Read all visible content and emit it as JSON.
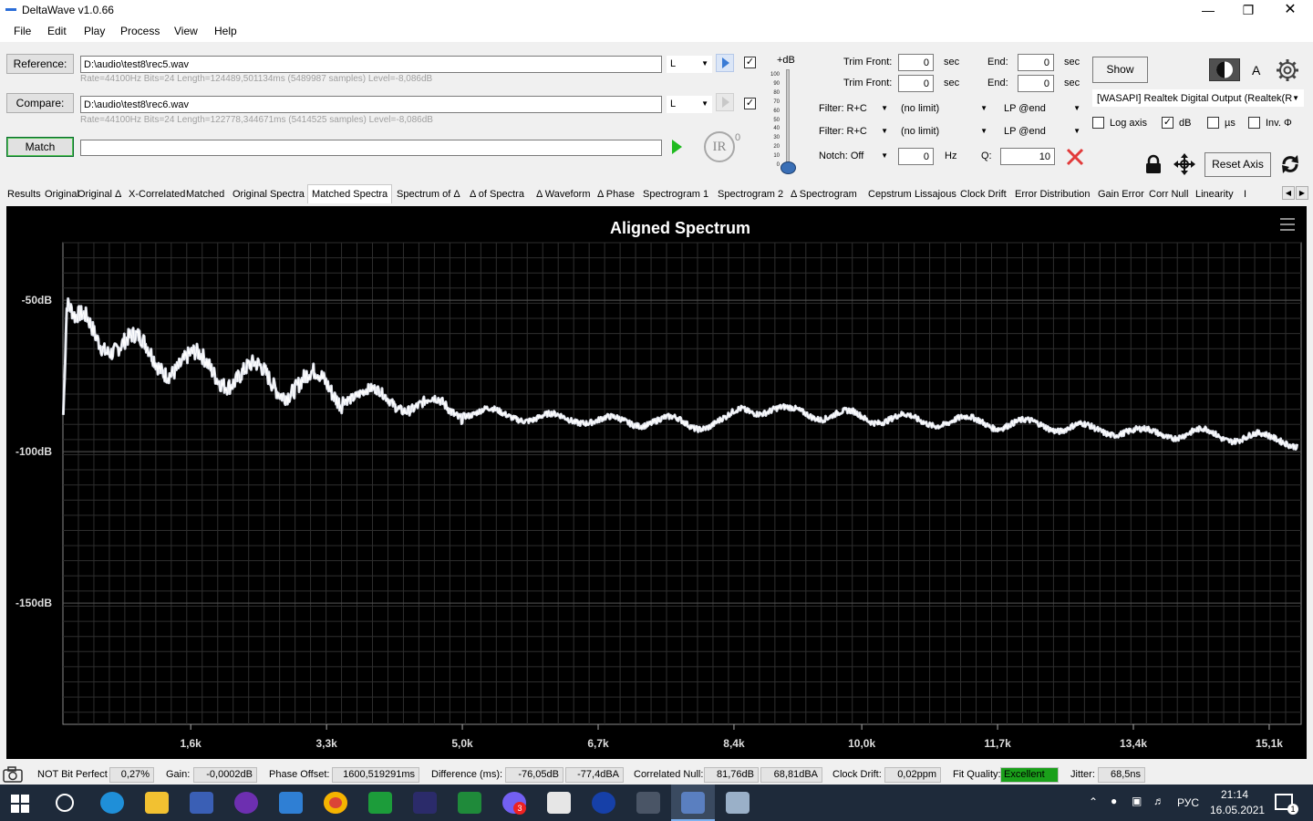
{
  "window": {
    "title": "DeltaWave v1.0.66"
  },
  "menu": [
    "File",
    "Edit",
    "Play",
    "Process",
    "View",
    "Help"
  ],
  "reference": {
    "button": "Reference:",
    "path": "D:\\audio\\test8\\rec5.wav",
    "channel": "L",
    "info": "Rate=44100Hz Bits=24 Length=124489,501134ms (5489987 samples) Level=-8,086dB"
  },
  "compare": {
    "button": "Compare:",
    "path": "D:\\audio\\test8\\rec6.wav",
    "channel": "L",
    "info": "Rate=44100Hz Bits=24 Length=122778,344671ms (5414525 samples) Level=-8,086dB"
  },
  "match": {
    "button": "Match",
    "value": ""
  },
  "ir": {
    "label": "IR",
    "sup": "0"
  },
  "db_scale": {
    "label": "+dB",
    "ticks": [
      "100",
      "90",
      "80",
      "70",
      "60",
      "50",
      "40",
      "30",
      "20",
      "10",
      "0"
    ]
  },
  "trim": {
    "front_label": "Trim Front:",
    "end_label": "End:",
    "unit": "sec",
    "ref_front": "0",
    "ref_end": "0",
    "cmp_front": "0",
    "cmp_end": "0"
  },
  "filters": [
    {
      "type": "Filter: R+C",
      "limit": "(no limit)",
      "lp": "LP @end"
    },
    {
      "type": "Filter: R+C",
      "limit": "(no limit)",
      "lp": "LP @end"
    }
  ],
  "notch": {
    "label": "Notch: Off",
    "hz": "0",
    "hz_unit": "Hz",
    "q_label": "Q:",
    "q": "10"
  },
  "show_button": "Show",
  "theme_letter": "A",
  "output_device": "[WASAPI] Realtek Digital Output (Realtek(R",
  "options": [
    {
      "label": "Log axis",
      "checked": false
    },
    {
      "label": "dB",
      "checked": true
    },
    {
      "label": "µs",
      "checked": false
    },
    {
      "label": "Inv. Φ",
      "checked": false
    }
  ],
  "reset_axis": "Reset Axis",
  "tabs": [
    "Results",
    "Original",
    "Original Δ",
    "X-Correlated",
    "Matched",
    "Original Spectra",
    "Matched Spectra",
    "Spectrum of Δ",
    "Δ of Spectra",
    "Δ Waveform",
    "Δ Phase",
    "Spectrogram 1",
    "Spectrogram 2",
    "Δ Spectrogram",
    "Cepstrum",
    "Lissajous",
    "Clock Drift",
    "Error Distribution",
    "Gain Error",
    "Corr Null",
    "Linearity",
    "I"
  ],
  "active_tab": "Matched Spectra",
  "chart_data": {
    "type": "line",
    "title": "Aligned Spectrum",
    "xlabel": "",
    "ylabel": "",
    "xlim": [
      0,
      15500
    ],
    "ylim": [
      -190,
      -31
    ],
    "x_ticks": [
      "1,6k",
      "3,3k",
      "5,0k",
      "6,7k",
      "8,4k",
      "10,0k",
      "11,7k",
      "13,4k",
      "15,1k"
    ],
    "x_tick_values": [
      1600,
      3300,
      5000,
      6700,
      8400,
      10000,
      11700,
      13400,
      15100
    ],
    "y_ticks": [
      "-50dB",
      "-100dB",
      "-150dB"
    ],
    "y_tick_values": [
      -50,
      -100,
      -150
    ],
    "grid": true,
    "line_color": "#d8dce6",
    "series": [
      {
        "x": [
          5,
          50,
          150,
          300,
          500,
          700,
          900,
          1100,
          1300,
          1500,
          1700,
          1900,
          2100,
          2300,
          2500,
          2700,
          2900,
          3100,
          3300,
          3500,
          3700,
          3900,
          4100,
          4300,
          4500,
          4700,
          4900,
          5100,
          5300,
          5500,
          5700,
          5900,
          6100,
          6300,
          6500,
          6700,
          6900,
          7100,
          7300,
          7500,
          7700,
          7900,
          8100,
          8300,
          8500,
          8700,
          8900,
          9100,
          9300,
          9500,
          9700,
          9900,
          10100,
          10300,
          10500,
          10700,
          10900,
          11100,
          11300,
          11500,
          11700,
          11900,
          12100,
          12300,
          12500,
          12700,
          12900,
          13100,
          13300,
          13500,
          13700,
          13900,
          14100,
          14300,
          14500,
          14700,
          14900,
          15100,
          15300,
          15450
        ],
        "values": [
          -88,
          -53,
          -60,
          -58,
          -62,
          -64,
          -66,
          -68,
          -70,
          -71,
          -72,
          -73,
          -74,
          -75,
          -76,
          -77,
          -77,
          -78,
          -79,
          -80,
          -81,
          -82,
          -83,
          -84,
          -85,
          -85,
          -86,
          -87,
          -87,
          -88,
          -88,
          -89,
          -89,
          -89,
          -89,
          -90,
          -90,
          -90,
          -90,
          -90,
          -90,
          -91,
          -91,
          -90,
          -86,
          -86,
          -86,
          -87,
          -87,
          -88,
          -88,
          -88,
          -89,
          -89,
          -89,
          -90,
          -90,
          -90,
          -90,
          -90,
          -91,
          -91,
          -91,
          -91,
          -92,
          -92,
          -93,
          -93,
          -93,
          -94,
          -94,
          -94,
          -94,
          -94,
          -95,
          -95,
          -95,
          -96,
          -96,
          -97
        ]
      }
    ]
  },
  "status": {
    "bit_perfect": "NOT Bit Perfect",
    "bit_pct": "0,27%",
    "gain_label": "Gain:",
    "gain": "-0,0002dB",
    "phase_label": "Phase Offset:",
    "phase": "1600,519291ms",
    "diff_label": "Difference (ms):",
    "diff_db": "-76,05dB",
    "diff_dba": "-77,4dBA",
    "corr_label": "Correlated Null:",
    "corr_db": "81,76dB",
    "corr_dba": "68,81dBA",
    "clock_label": "Clock Drift:",
    "clock": "0,02ppm",
    "fit_label": "Fit Quality:",
    "fit": "Excellent",
    "jitter_label": "Jitter:",
    "jitter": "68,5ns"
  },
  "taskbar": {
    "lang": "РУС",
    "time": "21:14",
    "date": "16.05.2021",
    "notif": "1",
    "badge": "3"
  }
}
